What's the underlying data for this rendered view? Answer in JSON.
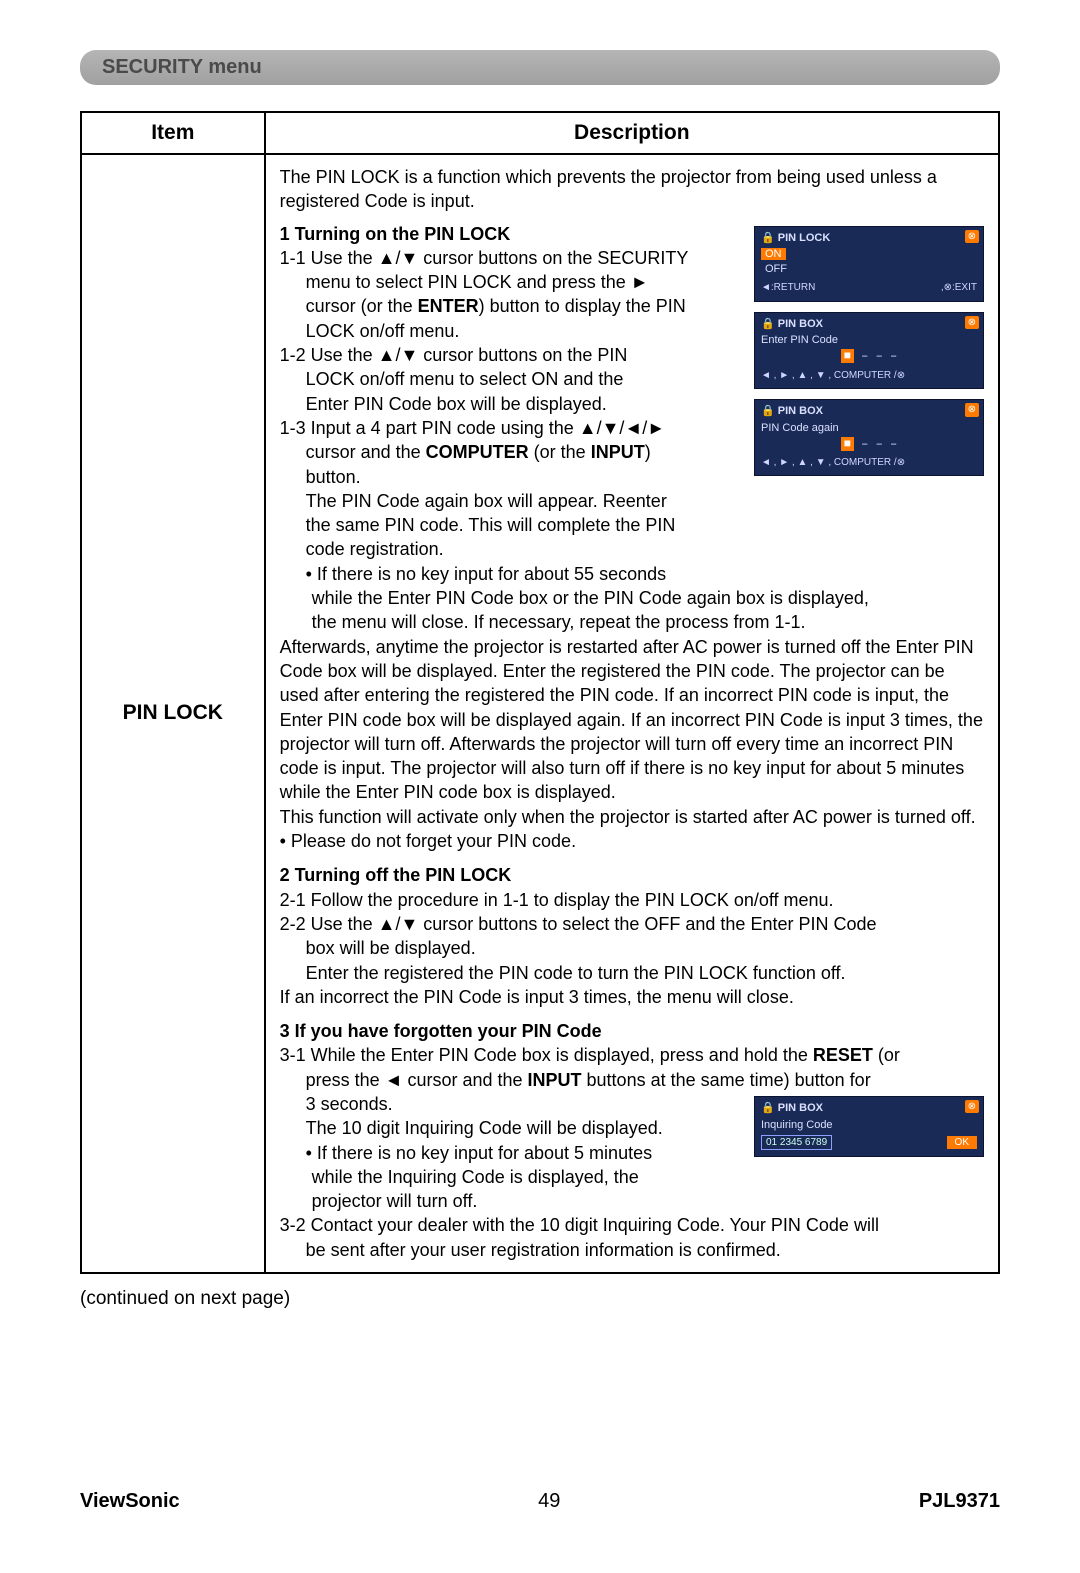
{
  "header": {
    "title": "SECURITY menu"
  },
  "table": {
    "header_item": "Item",
    "header_desc": "Description",
    "row_label": "PIN LOCK",
    "intro": "The PIN LOCK is a function which prevents the projector from being used unless a registered Code is input.",
    "sec1": {
      "title": "1 Turning on the PIN LOCK",
      "s1_1a": "1-1 Use the ▲/▼ cursor buttons on the SECURITY",
      "s1_1b": "menu to select PIN LOCK and press the ►",
      "s1_1c_pre": "cursor (or the ",
      "s1_1c_bold": "ENTER",
      "s1_1c_post": ") button to display the PIN",
      "s1_1d": "LOCK on/off menu.",
      "s1_2a": "1-2 Use the ▲/▼ cursor buttons on the PIN",
      "s1_2b": "LOCK on/off menu to select ON and the",
      "s1_2c": "Enter PIN Code box will be displayed.",
      "s1_3a": "1-3 Input a 4 part PIN code using the ▲/▼/◄/►",
      "s1_3b_pre": "cursor and the ",
      "s1_3b_bold": "COMPUTER",
      "s1_3b_mid": " (or the ",
      "s1_3b_bold2": "INPUT",
      "s1_3b_post": ")",
      "s1_3c": "button.",
      "s1_3d": "The PIN Code again box will appear. Reenter",
      "s1_3e": "the same PIN code. This will complete the PIN",
      "s1_3f": "code registration.",
      "note1a": "• If there is no key input for about 55 seconds",
      "note1b": "while the Enter PIN Code box or the PIN Code again box is displayed,",
      "note1c": "the menu will close. If necessary, repeat the process from 1-1.",
      "after1": "Afterwards, anytime the projector is restarted after AC power  is turned off the Enter PIN Code box will be displayed. Enter the registered the PIN code. The projector can be used after entering the registered the PIN code. If an incorrect PIN code is input, the Enter PIN code box will be displayed again. If an incorrect PIN Code is input 3 times, the projector will turn off. Afterwards the projector will turn off every time an incorrect PIN code is input. The projector will also turn off if there is no key input for about 5 minutes while the Enter PIN code box is displayed.",
      "after2": "This function will activate only when the projector is started after AC power is turned off.",
      "after3": "• Please do not forget your PIN code."
    },
    "sec2": {
      "title": "2 Turning off the PIN LOCK",
      "s2_1": "2-1  Follow the procedure in 1-1 to display the PIN LOCK on/off menu.",
      "s2_2a": "2-2  Use the ▲/▼ cursor buttons to select the OFF and the Enter PIN Code",
      "s2_2b": "box will be displayed.",
      "s2_2c": "Enter the registered the PIN code to turn the PIN LOCK function off.",
      "s2_end": "If an incorrect the PIN Code is input 3 times, the menu will close."
    },
    "sec3": {
      "title": "3 If you have forgotten your PIN Code",
      "s3_1a_pre": "3-1  While the Enter PIN Code box is displayed, press and hold the ",
      "s3_1a_bold": "RESET",
      "s3_1a_post": " (or",
      "s3_1b_pre": "press the ◄ cursor and the ",
      "s3_1b_bold": "INPUT",
      "s3_1b_post": " buttons at the same time) button for",
      "s3_1c": "3 seconds.",
      "s3_1d": "The 10 digit Inquiring Code will be displayed.",
      "s3_1e": "• If there is no key input for about 5 minutes",
      "s3_1f": "while the Inquiring Code is displayed, the",
      "s3_1g": "projector will turn off.",
      "s3_2a": "3-2  Contact your dealer with the 10 digit Inquiring Code. Your PIN Code will",
      "s3_2b": "be sent after your user registration information is confirmed."
    }
  },
  "insets": {
    "set1": {
      "title": "PIN LOCK",
      "on": "ON",
      "off": "OFF",
      "return": "◄:RETURN",
      "exit": ",⊗:EXIT"
    },
    "set2": {
      "title": "PIN BOX",
      "label": "Enter PIN Code",
      "boxes_first": "■",
      "boxes_rest": " – – –",
      "cmds": "◄ , ► , ▲ , ▼ , COMPUTER /⊗"
    },
    "set3": {
      "title": "PIN BOX",
      "label": "PIN Code again",
      "boxes_first": "■",
      "boxes_rest": " – – –",
      "cmds": "◄ , ► , ▲ , ▼ , COMPUTER /⊗"
    },
    "set4": {
      "title": "PIN BOX",
      "label": "Inquiring Code",
      "code": "01 2345 6789",
      "ok": "OK"
    }
  },
  "continued": "(continued on next page)",
  "footer": {
    "brand": "ViewSonic",
    "page": "49",
    "model": "PJL9371"
  }
}
